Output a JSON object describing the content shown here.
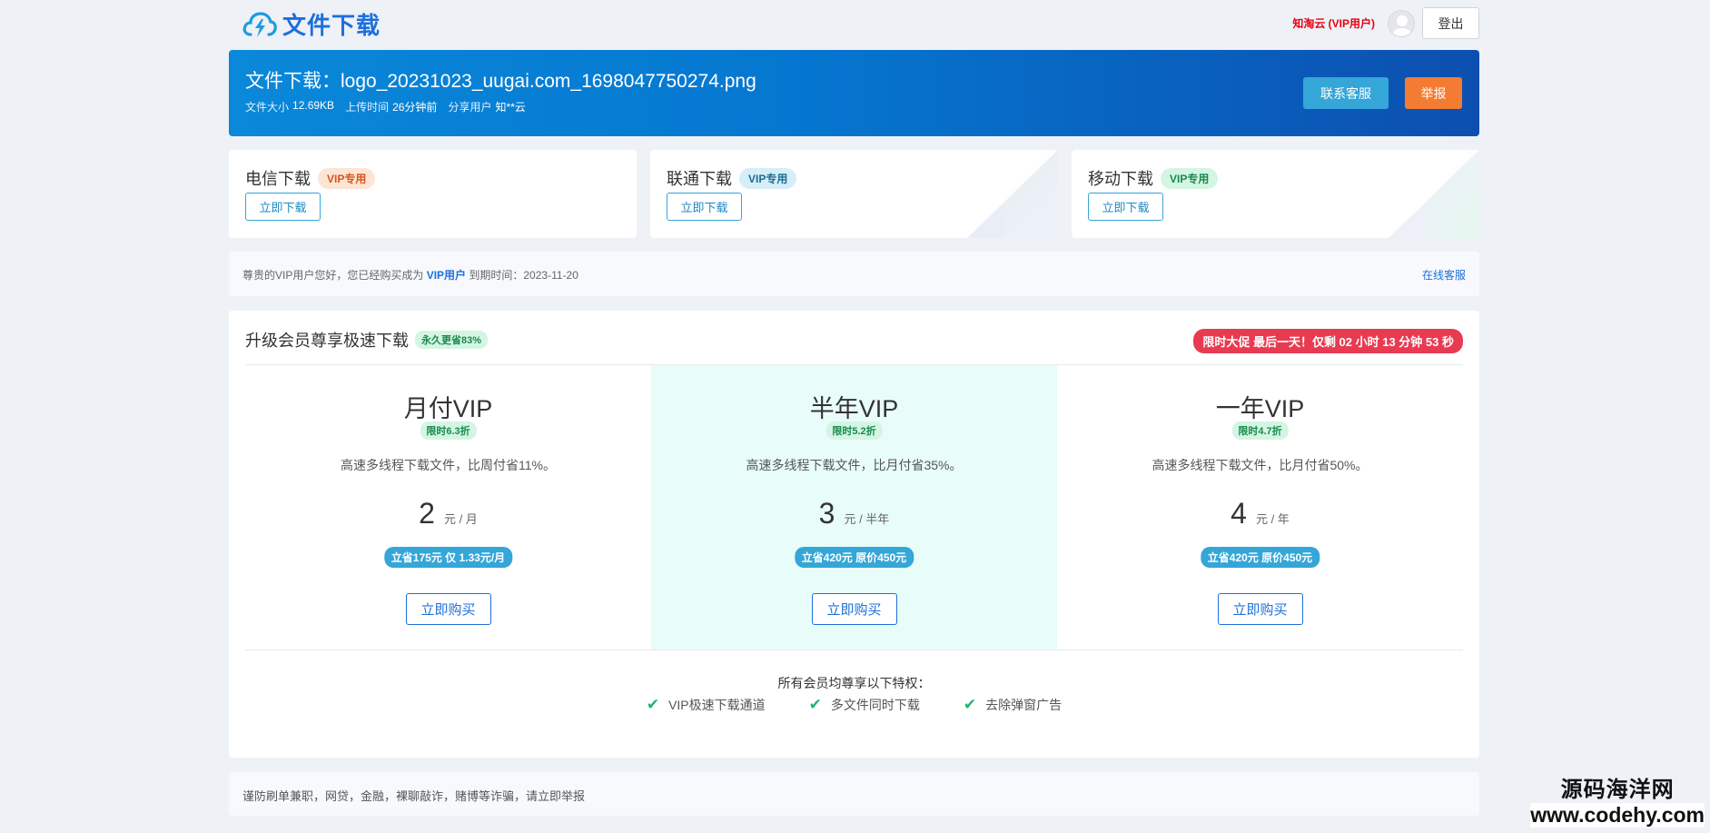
{
  "header": {
    "logo_text": "文件下载",
    "user_name": "知淘云 (VIP用户)",
    "logout_label": "登出"
  },
  "banner": {
    "title": "文件下载：logo_20231023_uugai.com_1698047750274.png",
    "size_label": "文件大小",
    "size_value": "12.69KB",
    "time_label": "上传时间",
    "time_value": "26分钟前",
    "user_label": "分享用户",
    "user_value": "知**云",
    "service_label": "联系客服",
    "report_label": "举报"
  },
  "downloads": [
    {
      "title": "电信下载",
      "tag": "VIP专用",
      "button": "立即下载"
    },
    {
      "title": "联通下载",
      "tag": "VIP专用",
      "button": "立即下载"
    },
    {
      "title": "移动下载",
      "tag": "VIP专用",
      "button": "立即下载"
    }
  ],
  "notice": {
    "prefix": "尊贵的VIP用户您好，您已经购买成为",
    "vip": "VIP用户",
    "expiry": "到期时间：2023-11-20",
    "online_service": "在线客服"
  },
  "upgrade": {
    "title": "升级会员尊享极速下载",
    "forever_tag": "永久更省83%",
    "promo": "限时大促 最后一天！仅剩 02 小时 13 分钟 53 秒",
    "plans": [
      {
        "name": "月付VIP",
        "tag": "限时6.3折",
        "desc": "高速多线程下载文件，比周付省11%。",
        "price": "2",
        "unit": "元 / 月",
        "save": "立省175元 仅 1.33元/月",
        "button": "立即购买"
      },
      {
        "name": "半年VIP",
        "tag": "限时5.2折",
        "desc": "高速多线程下载文件，比月付省35%。",
        "price": "3",
        "unit": "元 / 半年",
        "save": "立省420元 原价450元",
        "button": "立即购买"
      },
      {
        "name": "一年VIP",
        "tag": "限时4.7折",
        "desc": "高速多线程下载文件，比月付省50%。",
        "price": "4",
        "unit": "元 / 年",
        "save": "立省420元 原价450元",
        "button": "立即购买"
      }
    ],
    "privileges_title": "所有会员均尊享以下特权：",
    "privileges": [
      "VIP极速下载通道",
      "多文件同时下载",
      "去除弹窗广告"
    ]
  },
  "bottom_notice": "谨防刷单兼职，网贷，金融，裸聊敲诈，赌博等诈骗，请立即举报",
  "watermark": {
    "line1": "源码海洋网",
    "line2": "www.codehy.com"
  },
  "colors": {
    "brand": "#1e6fd9",
    "accent_orange": "#f47c32",
    "accent_cyan": "#35a6d8",
    "promo_red": "#e83b52",
    "success_green": "#1db66e"
  },
  "icons": {
    "logo": "cloud-lightning-icon",
    "avatar": "user-avatar-icon",
    "check": "check-icon"
  }
}
